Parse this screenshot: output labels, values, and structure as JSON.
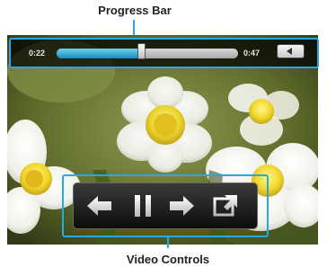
{
  "annotations": {
    "progress_bar_label": "Progress Bar",
    "video_controls_label": "Video Controls",
    "accent_color": "#29a8e0"
  },
  "player": {
    "elapsed": "0:22",
    "total": "0:47",
    "progress_fraction": 0.468
  },
  "controls": {
    "buttons": [
      "previous-icon",
      "pause-icon",
      "next-icon",
      "fullscreen-icon"
    ]
  }
}
